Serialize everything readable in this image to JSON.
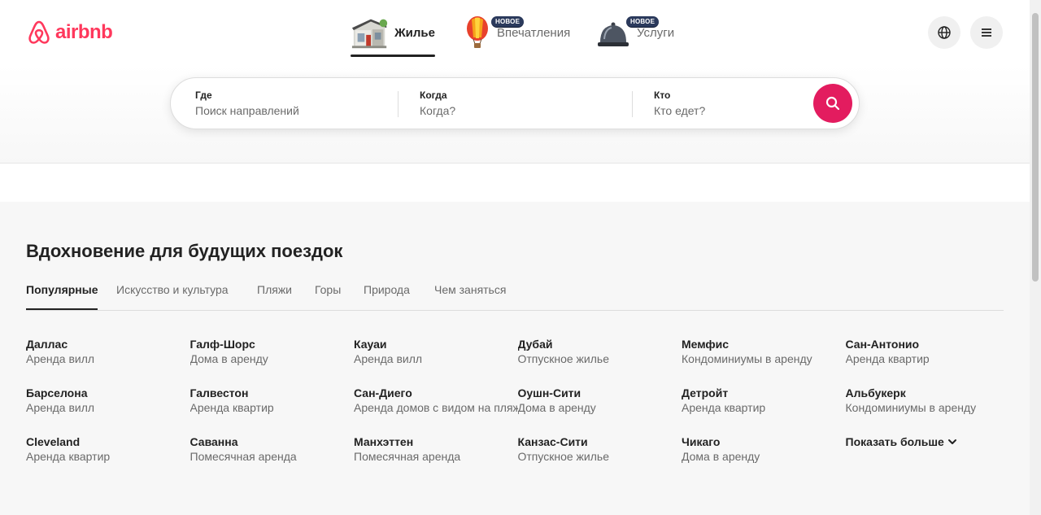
{
  "brand": {
    "name": "airbnb",
    "color": "#ff385c"
  },
  "header": {
    "categories": [
      {
        "label": "Жилье",
        "icon": "house-icon",
        "active": true
      },
      {
        "label": "Впечатления",
        "icon": "hot-air-balloon-icon",
        "badge": "НОВОЕ"
      },
      {
        "label": "Услуги",
        "icon": "service-bell-icon",
        "badge": "НОВОЕ"
      }
    ],
    "language_icon": "globe-icon",
    "menu_icon": "hamburger-menu-icon"
  },
  "search": {
    "where": {
      "label": "Где",
      "placeholder": "Поиск направлений"
    },
    "when": {
      "label": "Когда",
      "placeholder": "Когда?"
    },
    "who": {
      "label": "Кто",
      "placeholder": "Кто едет?"
    },
    "button_icon": "search-icon",
    "button_color": "#e31c5f"
  },
  "inspiration": {
    "title": "Вдохновение для будущих поездок",
    "tabs": [
      "Популярные",
      "Искусство и культура",
      "Пляжи",
      "Горы",
      "Природа",
      "Чем заняться"
    ],
    "active_tab": 0,
    "destinations": [
      {
        "city": "Даллас",
        "type": "Аренда вилл"
      },
      {
        "city": "Галф-Шорс",
        "type": "Дома в аренду"
      },
      {
        "city": "Кауаи",
        "type": "Аренда вилл"
      },
      {
        "city": "Дубай",
        "type": "Отпускное жилье"
      },
      {
        "city": "Мемфис",
        "type": "Кондоминиумы в аренду"
      },
      {
        "city": "Сан-Антонио",
        "type": "Аренда квартир"
      },
      {
        "city": "Барселона",
        "type": "Аренда вилл"
      },
      {
        "city": "Галвестон",
        "type": "Аренда квартир"
      },
      {
        "city": "Сан-Диего",
        "type": "Аренда домов с видом на пляж"
      },
      {
        "city": "Оушн-Сити",
        "type": "Дома в аренду"
      },
      {
        "city": "Детройт",
        "type": "Аренда квартир"
      },
      {
        "city": "Альбукерк",
        "type": "Кондоминиумы в аренду"
      },
      {
        "city": "Cleveland",
        "type": "Аренда квартир"
      },
      {
        "city": "Саванна",
        "type": "Помесячная аренда"
      },
      {
        "city": "Манхэттен",
        "type": "Помесячная аренда"
      },
      {
        "city": "Канзас-Сити",
        "type": "Отпускное жилье"
      },
      {
        "city": "Чикаго",
        "type": "Дома в аренду"
      }
    ],
    "show_more": "Показать больше"
  }
}
